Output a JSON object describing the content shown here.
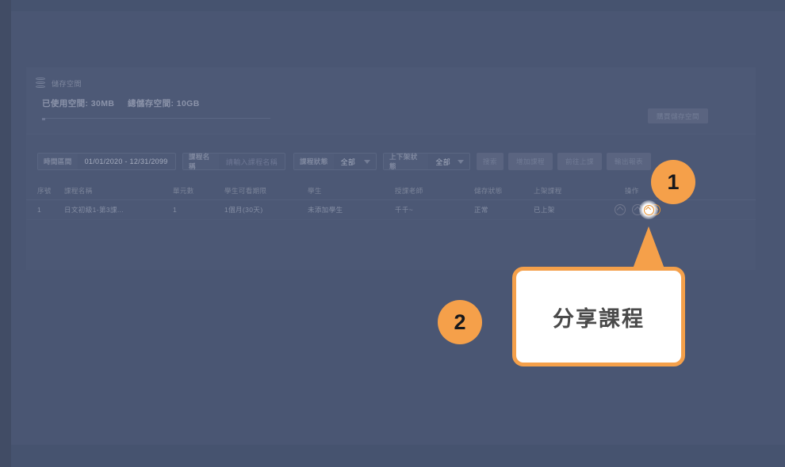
{
  "storage": {
    "icon": "database-icon",
    "title": "儲存空間",
    "used_label": "已使用空間: 30MB",
    "total_label": "總儲存空間: 10GB",
    "buy_button": "購買儲存空間",
    "usage_percent": 0.3
  },
  "toolbar": {
    "date_range_label": "時間區間",
    "date_range_value": "01/01/2020 - 12/31/2099",
    "course_name_label": "課程名稱",
    "course_name_placeholder": "請輸入課程名稱",
    "course_status_label": "課程狀態",
    "course_status_value": "全部",
    "shelf_status_label": "上下架狀態",
    "shelf_status_value": "全部",
    "search_button": "搜索",
    "add_course_button": "增加課程",
    "go_class_button": "前往上課",
    "export_report_button": "輸出報表"
  },
  "table": {
    "headers": [
      "序號",
      "課程名稱",
      "單元數",
      "學生可看期限",
      "學生",
      "授課老師",
      "儲存狀態",
      "上架課程",
      "操作"
    ],
    "rows": [
      {
        "index": "1",
        "course_name": "日文初級1-第3課...",
        "units": "1",
        "view_period": "1個月(30天)",
        "students": "未添加學生",
        "teacher": "千千~",
        "save_status": "正常",
        "shelf_status": "已上架",
        "actions": [
          "edit-icon",
          "preview-icon",
          "share-icon"
        ]
      }
    ]
  },
  "coach_marks": {
    "step_one": "1",
    "step_two": "2",
    "callout_text": "分享課程"
  },
  "colors": {
    "accent": "#f5a04a",
    "overlay": "#46536f",
    "panel": "#4c5875",
    "callout_bg": "#ffffff",
    "callout_text": "#4a4a4a"
  }
}
